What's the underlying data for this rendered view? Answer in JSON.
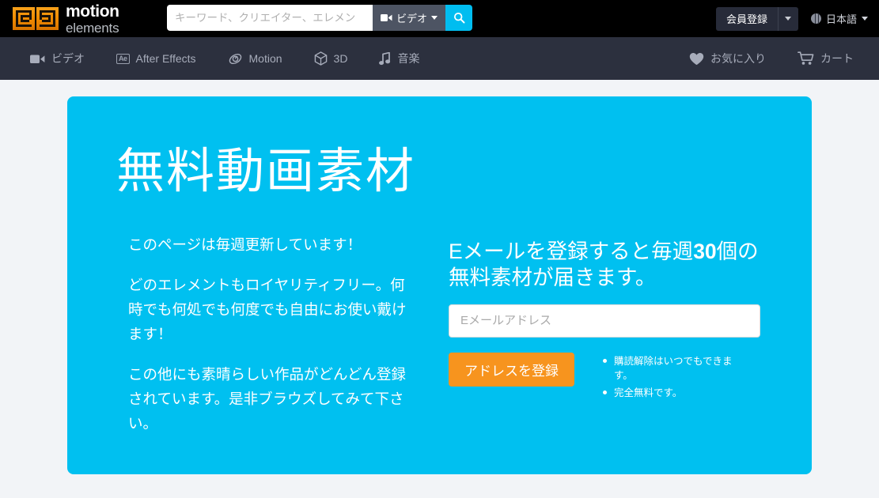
{
  "brand": {
    "name_line1": "motion",
    "name_line2": "elements",
    "logo_icon": "motionelements-logo-icon"
  },
  "search": {
    "placeholder": "キーワード、クリエイター、エレメン",
    "value": "",
    "type_label": "ビデオ",
    "type_icon": "video-camera-icon",
    "caret_icon": "chevron-down-icon",
    "button_icon": "search-icon",
    "button_color": "#00bdf0"
  },
  "account": {
    "signup_label": "会員登録",
    "signup_caret_icon": "chevron-down-icon",
    "language_label": "日本語",
    "language_icon": "globe-icon",
    "language_caret_icon": "chevron-down-icon"
  },
  "nav": {
    "items": [
      {
        "label": "ビデオ",
        "icon": "video-camera-icon"
      },
      {
        "label": "After Effects",
        "icon": "after-effects-badge-icon"
      },
      {
        "label": "Motion",
        "icon": "motion-swirl-icon"
      },
      {
        "label": "3D",
        "icon": "cube-icon"
      },
      {
        "label": "音楽",
        "icon": "music-note-icon"
      }
    ],
    "right_items": [
      {
        "label": "お気に入り",
        "icon": "heart-icon"
      },
      {
        "label": "カート",
        "icon": "shopping-cart-icon"
      }
    ]
  },
  "hero": {
    "background_color": "#00c0f0",
    "title": "無料動画素材",
    "paragraphs": [
      "このページは毎週更新しています！",
      "どのエレメントもロイヤリティフリー。何時でも何処でも何度でも自由にお使い戴けます！",
      "この他にも素晴らしい作品がどんどん登録されています。是非ブラウズしてみて下さい。"
    ],
    "signup": {
      "heading_pre": "Eメールを登録すると毎週",
      "heading_number": "30",
      "heading_post": "個の無料素材が届きます。",
      "email_placeholder": "Eメールアドレス",
      "email_value": "",
      "cta_label": "アドレスを登録",
      "cta_color": "#f7941e",
      "benefits": [
        "購読解除はいつでもできます。",
        "完全無料です。"
      ]
    }
  }
}
